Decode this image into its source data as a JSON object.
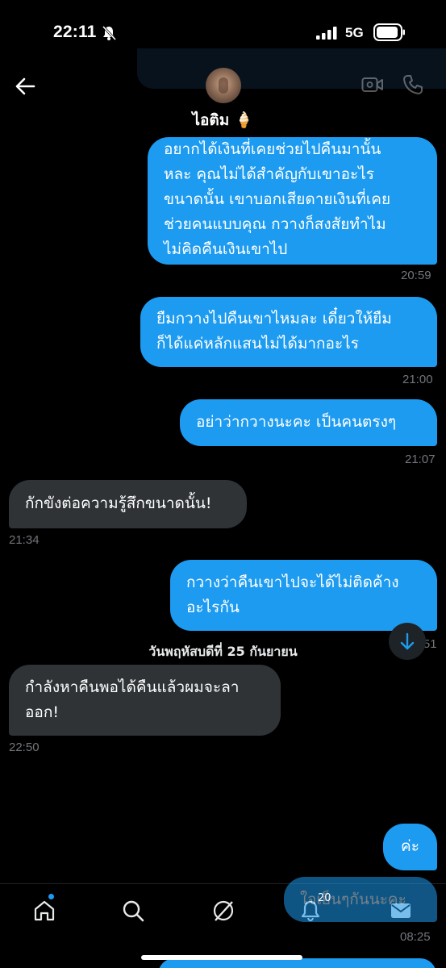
{
  "status_bar": {
    "time": "22:11",
    "network": "5G"
  },
  "header": {
    "contact_name": "ไอติม 🍦"
  },
  "messages": [
    {
      "type": "sent",
      "lines": [
        "อยากได้เงินที่เคยช่วยไปคืนมานั้น",
        "หละ คุณไม่ได้สำคัญกับเขาอะไร",
        "ขนาดนั้น เขาบอกเสียดายเงินที่เคย",
        "ช่วยคนแบบคุณ กวางก็สงสัยทำไม",
        "ไม่คิดคืนเงินเขาไป"
      ],
      "time": "20:59"
    },
    {
      "type": "sent",
      "lines": [
        "ยืมกวางไปคืนเขาไหมละ เดี๋ยวให้ยืม",
        "ก็ได้แค่หลักแสนไม่ได้มากอะไร"
      ],
      "time": "21:00"
    },
    {
      "type": "sent",
      "lines": [
        "อย่าว่ากวางนะคะ เป็นคนตรงๆ"
      ],
      "time": "21:07"
    },
    {
      "type": "recv",
      "lines": [
        "กักขังต่อความรู้สึกขนาดนั้น!"
      ],
      "time": "21:34"
    },
    {
      "type": "sent",
      "lines": [
        "กวางว่าคืนเขาไปจะได้ไม่ติดค้าง",
        "อะไรกัน"
      ],
      "time": "21:51"
    },
    {
      "type": "recv",
      "lines": [
        "กำลังหาคืนพอได้คืนแล้วผมจะลา",
        "ออก!"
      ],
      "time": "22:50"
    },
    {
      "type": "sent",
      "lines": [
        "ค่ะ"
      ],
      "time": ""
    }
  ],
  "date_separator": "วันพฤหัสบดีที่ 25 กันยายน",
  "overlay_message": "ใจเย็นๆกันนะคะ",
  "overlay_badge": "20",
  "last_time": "08:25",
  "colors": {
    "sent": "#1d9bf0",
    "received": "#2f3336",
    "background": "#000000",
    "muted": "#71767b"
  },
  "icons": [
    "back-arrow-icon",
    "video-call-icon",
    "phone-icon",
    "home-icon",
    "search-icon",
    "grok-icon",
    "bell-icon",
    "mail-icon",
    "scroll-down-icon"
  ]
}
